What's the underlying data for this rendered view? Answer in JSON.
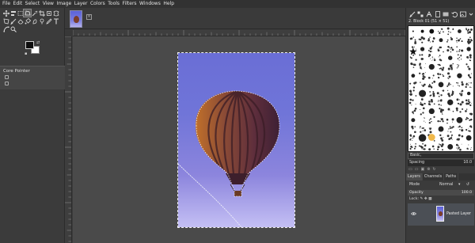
{
  "menubar": {
    "items": [
      "File",
      "Edit",
      "Select",
      "View",
      "Image",
      "Layer",
      "Colors",
      "Tools",
      "Filters",
      "Windows",
      "Help"
    ]
  },
  "toolbox": {
    "tools": [
      "move-tool-icon",
      "align-tool-icon",
      "rect-select-icon",
      "free-select-icon",
      "fuzzy-select-icon",
      "crop-icon",
      "unified-transform-icon",
      "warp-transform-icon",
      "handle-transform-icon",
      "paintbrush-icon",
      "eraser-icon",
      "bucket-fill-icon",
      "smudge-icon",
      "clone-icon",
      "color-picker-icon",
      "text-icon",
      "paths-icon",
      "zoom-icon"
    ],
    "tool_options_title": "Core Pointer"
  },
  "brushes": {
    "name": "2. Block 01 (51 × 51)",
    "tag_filter": "Basic,",
    "spacing_label": "Spacing",
    "spacing_value": "10.0"
  },
  "layers": {
    "tabs": [
      "Layers",
      "Channels",
      "Paths"
    ],
    "mode_label": "Mode",
    "mode_value": "Normal",
    "opacity_label": "Opacity",
    "opacity_value": "100.0",
    "lock_label": "Lock:",
    "items": [
      {
        "name": "Pasted Layer",
        "visible": true
      }
    ]
  },
  "colors": {
    "foreground": "#0d0d0d",
    "background": "#ffffff",
    "canvas": "#4a4a4a",
    "panel": "#3b3b3b"
  }
}
